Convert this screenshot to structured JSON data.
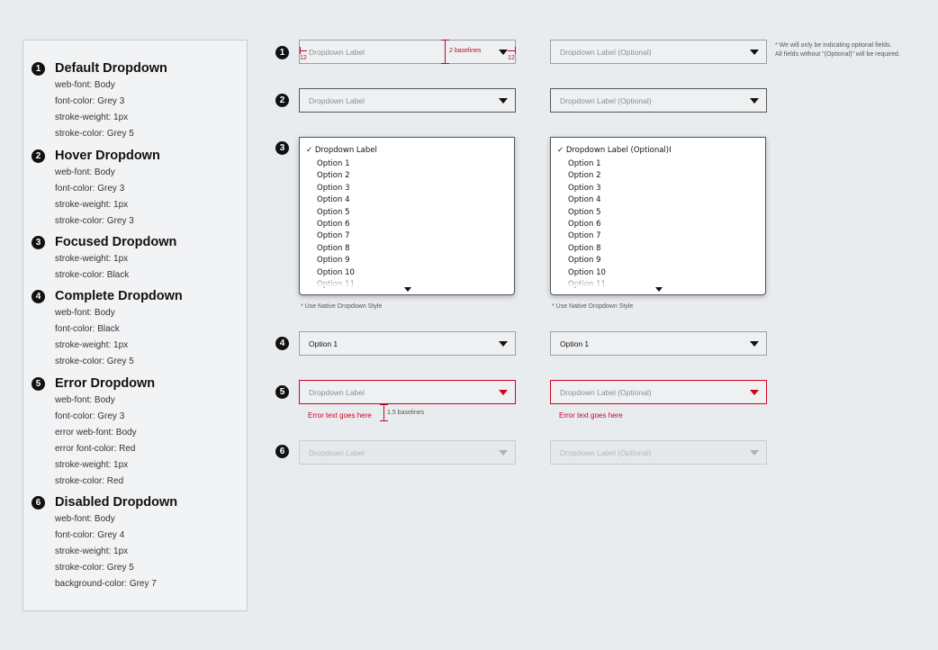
{
  "spec": [
    {
      "num": "1",
      "title": "Default Dropdown",
      "lines": [
        "web-font: Body",
        "font-color: Grey 3",
        "stroke-weight: 1px",
        "stroke-color: Grey 5"
      ]
    },
    {
      "num": "2",
      "title": "Hover Dropdown",
      "lines": [
        "web-font: Body",
        "font-color: Grey 3",
        "stroke-weight: 1px",
        "stroke-color: Grey 3"
      ]
    },
    {
      "num": "3",
      "title": "Focused Dropdown",
      "lines": [
        "stroke-weight: 1px",
        "stroke-color: Black"
      ]
    },
    {
      "num": "4",
      "title": "Complete Dropdown",
      "lines": [
        "web-font: Body",
        "font-color: Black",
        "stroke-weight: 1px",
        "stroke-color: Grey 5"
      ]
    },
    {
      "num": "5",
      "title": "Error Dropdown",
      "lines": [
        "web-font: Body",
        "font-color: Grey 3",
        "error web-font: Body",
        "error font-color: Red",
        "stroke-weight: 1px",
        "stroke-color: Red"
      ]
    },
    {
      "num": "6",
      "title": "Disabled Dropdown",
      "lines": [
        "web-font: Body",
        "font-color: Grey 4",
        "stroke-weight: 1px",
        "stroke-color: Grey 5",
        "background-color: Grey 7"
      ]
    }
  ],
  "rows": {
    "default": {
      "num": "1",
      "label": "Dropdown Label",
      "label_opt": "Dropdown Label (Optional)"
    },
    "hover": {
      "num": "2",
      "label": "Dropdown Label",
      "label_opt": "Dropdown Label (Optional)"
    },
    "focused": {
      "num": "3",
      "label": "✓ Dropdown Label",
      "label_opt": "✓ Dropdown Label (Optional)I",
      "options": [
        "Option 1",
        "Option 2",
        "Option 3",
        "Option 4",
        "Option 5",
        "Option 6",
        "Option 7",
        "Option 8",
        "Option 9",
        "Option 10",
        "Option 11"
      ],
      "note": "* Use Native Dropdown Style"
    },
    "complete": {
      "num": "4",
      "label": "Option 1",
      "label_opt": "Option 1"
    },
    "error": {
      "num": "5",
      "label": "Dropdown Label",
      "label_opt": "Dropdown Label (Optional)",
      "error_text": "Error text goes here"
    },
    "disabled": {
      "num": "6",
      "label": "Dropdown Label",
      "label_opt": "Dropdown Label (Optional)"
    }
  },
  "annotations": {
    "baselines_2": "2 baselines",
    "baselines_15": "1.5 baselines",
    "padding": "12",
    "optional_note_1": "* We will only be indicating optional fields.",
    "optional_note_2": "All fields without \"(Optional)\" will be required."
  },
  "colors": {
    "error": "#d0021b",
    "background": "#e9ecef"
  }
}
